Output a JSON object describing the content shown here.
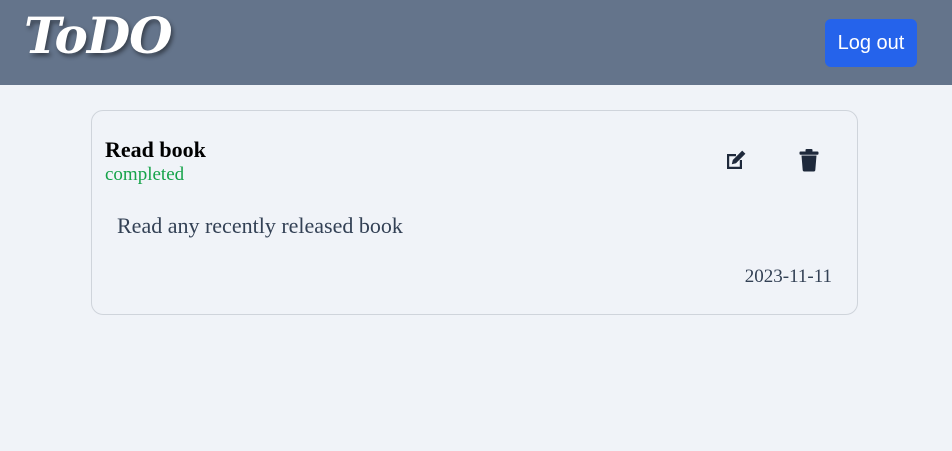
{
  "header": {
    "logo_text": "ToDO",
    "logout_label": "Log out"
  },
  "todo": {
    "title": "Read book",
    "status": "completed",
    "status_color": "#16a34a",
    "description": "Read any recently released book",
    "date": "2023-11-11",
    "actions": {
      "edit_icon": "edit-icon",
      "delete_icon": "trash-icon"
    }
  },
  "colors": {
    "header_bg": "#64748b",
    "accent": "#2563eb",
    "icon": "#1e293b"
  }
}
